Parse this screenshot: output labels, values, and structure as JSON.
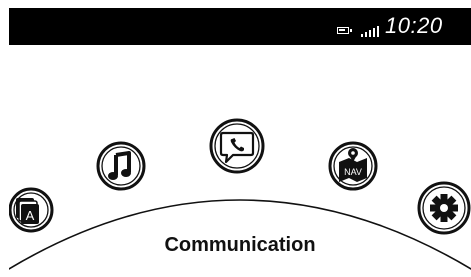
{
  "status": {
    "time": "10:20",
    "battery_icon": "battery-icon",
    "signal_icon": "signal-strength-icon"
  },
  "carousel": {
    "selected_label": "Communication",
    "items": [
      {
        "id": "entertainment",
        "icon": "entertainment-cards-icon",
        "glyph": "A"
      },
      {
        "id": "music",
        "icon": "music-note-icon"
      },
      {
        "id": "communication",
        "icon": "phone-message-icon",
        "selected": true
      },
      {
        "id": "navigation",
        "icon": "nav-map-pin-icon",
        "glyph": "NAV"
      },
      {
        "id": "settings",
        "icon": "gear-icon"
      }
    ]
  },
  "colors": {
    "bar": "#000000",
    "ink": "#111111",
    "background": "#ffffff"
  }
}
